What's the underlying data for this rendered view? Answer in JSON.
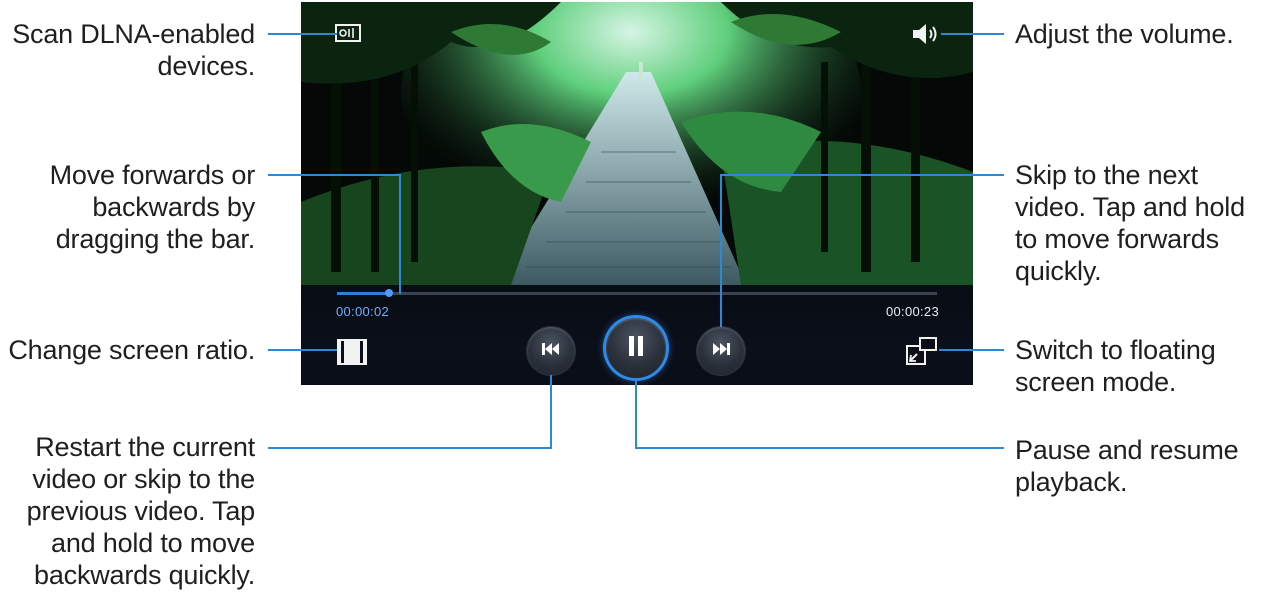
{
  "player": {
    "elapsed": "00:00:02",
    "total": "00:00:23",
    "progress_fraction": 0.087,
    "state": "playing"
  },
  "callouts": {
    "scan_dlna": "Scan DLNA-enabled\ndevices.",
    "seek_bar": "Move forwards or\nbackwards by\ndragging the bar.",
    "screen_ratio": "Change screen ratio.",
    "previous": "Restart the current\nvideo or skip to the\nprevious video. Tap\nand hold to move\nbackwards quickly.",
    "volume": "Adjust the volume.",
    "next": "Skip to the next\nvideo. Tap and hold\nto move forwards\nquickly.",
    "floating": "Switch to floating\nscreen mode.",
    "pause_resume": "Pause and resume\nplayback."
  },
  "icons": {
    "dlna": "dlna-scan-icon",
    "volume": "volume-icon",
    "ratio": "screen-ratio-icon",
    "previous": "previous-icon",
    "pause": "pause-icon",
    "next": "next-icon",
    "floating": "floating-screen-icon"
  },
  "colors": {
    "accent": "#2d8bea",
    "leader_line": "#2a8ad8",
    "elapsed_text": "#6cb0ff"
  }
}
